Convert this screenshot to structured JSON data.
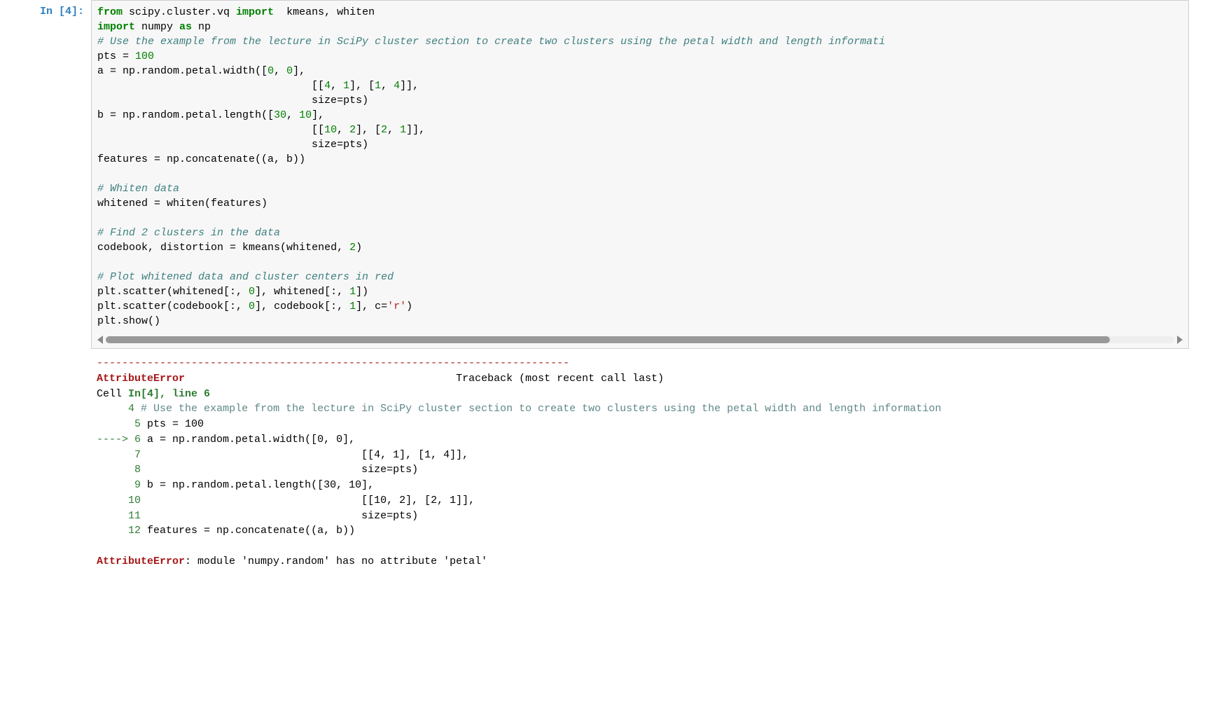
{
  "cell": {
    "prompt": "In [4]:",
    "code_html": "<span class='kw'>from</span> scipy.cluster.vq <span class='kw'>import</span>  kmeans, whiten\n<span class='kw'>import</span> numpy <span class='kw'>as</span> np\n<span class='cm'># Use the example from the lecture in SciPy cluster section to create two clusters using the petal width and length informati</span>\npts <span>=</span> <span class='nm'>100</span>\na <span>=</span> np.random.petal.width([<span class='nm'>0</span>, <span class='nm'>0</span>],\n                                  [[<span class='nm'>4</span>, <span class='nm'>1</span>], [<span class='nm'>1</span>, <span class='nm'>4</span>]],\n                                  size<span>=</span>pts)\nb <span>=</span> np.random.petal.length([<span class='nm'>30</span>, <span class='nm'>10</span>],\n                                  [[<span class='nm'>10</span>, <span class='nm'>2</span>], [<span class='nm'>2</span>, <span class='nm'>1</span>]],\n                                  size<span>=</span>pts)\nfeatures <span>=</span> np.concatenate((a, b))\n\n<span class='cm'># Whiten data</span>\nwhitened <span>=</span> whiten(features)\n\n<span class='cm'># Find 2 clusters in the data</span>\ncodebook, distortion <span>=</span> kmeans(whitened, <span class='nm'>2</span>)\n\n<span class='cm'># Plot whitened data and cluster centers in red</span>\nplt.scatter(whitened[:, <span class='nm'>0</span>], whitened[:, <span class='nm'>1</span>])\nplt.scatter(codebook[:, <span class='nm'>0</span>], codebook[:, <span class='nm'>1</span>], c<span>=</span><span class='st'>'r'</span>)\nplt.show()"
  },
  "error": {
    "dashes": "---------------------------------------------------------------------------",
    "name": "AttributeError",
    "traceback_label": "Traceback (most recent call last)",
    "cell_ref": "Cell ",
    "in_ref": "In[4], line 6",
    "lines": [
      {
        "num": "4",
        "text": "# Use the example from the lecture in SciPy cluster section to create two clusters using the petal width and length information",
        "faint": true
      },
      {
        "num": "5",
        "text": "pts = 100"
      },
      {
        "num": "6",
        "text": "a = np.random.petal.width([0, 0],",
        "arrow": true
      },
      {
        "num": "7",
        "text": "                                  [[4, 1], [1, 4]],"
      },
      {
        "num": "8",
        "text": "                                  size=pts)"
      },
      {
        "num": "9",
        "text": "b = np.random.petal.length([30, 10],"
      },
      {
        "num": "10",
        "text": "                                  [[10, 2], [2, 1]],"
      },
      {
        "num": "11",
        "text": "                                  size=pts)"
      },
      {
        "num": "12",
        "text": "features = np.concatenate((a, b))"
      }
    ],
    "final_name": "AttributeError",
    "final_msg": ": module 'numpy.random' has no attribute 'petal'"
  }
}
